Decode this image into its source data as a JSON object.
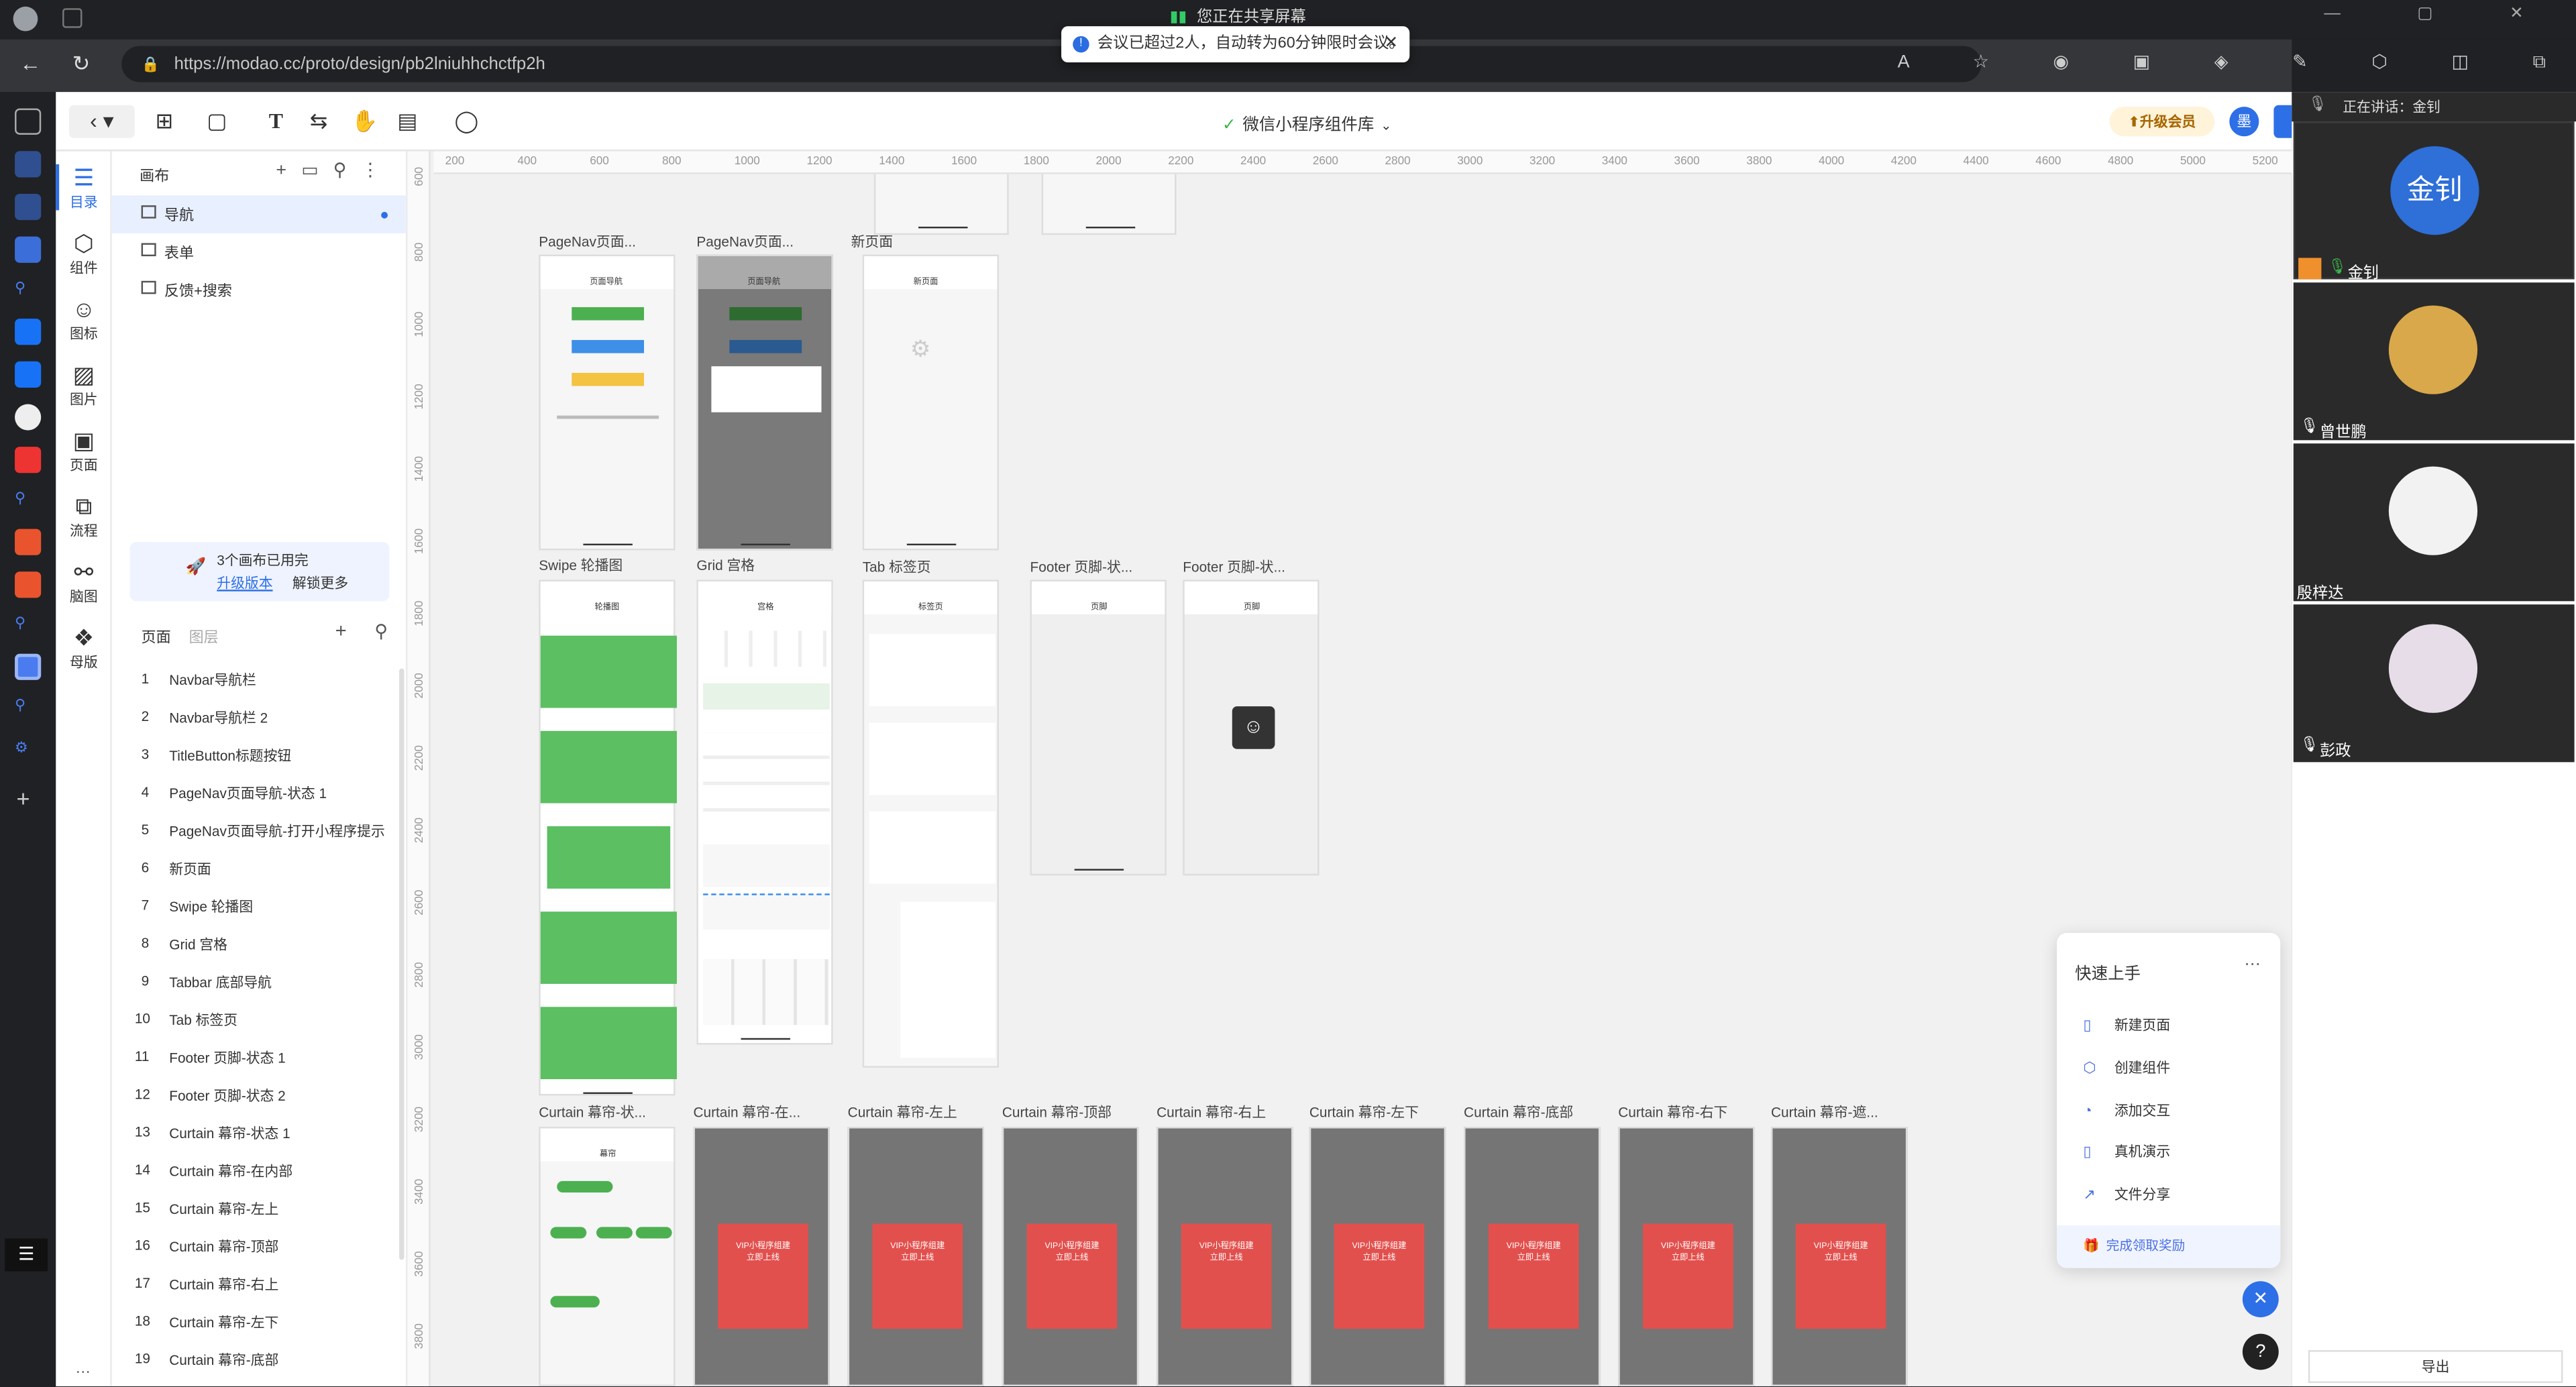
{
  "browser": {
    "sharing": "您正在共享屏幕",
    "url": "https://modao.cc/proto/design/pb2lniuhhchctfp2h",
    "toast": "会议已超过2人，自动转为60分钟限时会议。"
  },
  "app": {
    "project": "微信小程序组件库",
    "upgrade": "升级会员",
    "avatar": "墨"
  },
  "iconbar": [
    {
      "label": "目录",
      "icon": "list-icon"
    },
    {
      "label": "组件",
      "icon": "cube-icon"
    },
    {
      "label": "图标",
      "icon": "smile-icon"
    },
    {
      "label": "图片",
      "icon": "image-icon"
    },
    {
      "label": "页面",
      "icon": "page-icon"
    },
    {
      "label": "流程",
      "icon": "flow-icon"
    },
    {
      "label": "脑图",
      "icon": "mindmap-icon"
    },
    {
      "label": "母版",
      "icon": "master-icon"
    }
  ],
  "canvas_panel": {
    "title": "画布",
    "items": [
      "导航",
      "表单",
      "反馈+搜索"
    ],
    "quota": "3个画布已用完",
    "upgrade_link": "升级版本",
    "unlock": "解锁更多"
  },
  "pages": {
    "tabs": [
      "页面",
      "图层"
    ],
    "items": [
      {
        "n": "1",
        "t": "Navbar导航栏"
      },
      {
        "n": "2",
        "t": "Navbar导航栏 2"
      },
      {
        "n": "3",
        "t": "TitleButton标题按钮"
      },
      {
        "n": "4",
        "t": "PageNav页面导航-状态 1"
      },
      {
        "n": "5",
        "t": "PageNav页面导航-打开小程序提示"
      },
      {
        "n": "6",
        "t": "新页面"
      },
      {
        "n": "7",
        "t": "Swipe 轮播图"
      },
      {
        "n": "8",
        "t": "Grid 宫格"
      },
      {
        "n": "9",
        "t": "Tabbar 底部导航"
      },
      {
        "n": "10",
        "t": "Tab 标签页"
      },
      {
        "n": "11",
        "t": "Footer 页脚-状态 1"
      },
      {
        "n": "12",
        "t": "Footer 页脚-状态 2"
      },
      {
        "n": "13",
        "t": "Curtain 幕帘-状态 1"
      },
      {
        "n": "14",
        "t": "Curtain 幕帘-在内部"
      },
      {
        "n": "15",
        "t": "Curtain 幕帘-左上"
      },
      {
        "n": "16",
        "t": "Curtain 幕帘-顶部"
      },
      {
        "n": "17",
        "t": "Curtain 幕帘-右上"
      },
      {
        "n": "18",
        "t": "Curtain 幕帘-左下"
      },
      {
        "n": "19",
        "t": "Curtain 幕帘-底部"
      }
    ]
  },
  "ruler_h": [
    "200",
    "400",
    "600",
    "800",
    "1000",
    "1200",
    "1400",
    "1600",
    "1800",
    "2000",
    "2200",
    "2400",
    "2600",
    "2800",
    "3000",
    "3200",
    "3400",
    "3600",
    "3800",
    "4000",
    "4200",
    "4400",
    "4600",
    "4800",
    "5000",
    "5200"
  ],
  "ruler_v": [
    "600",
    "800",
    "1000",
    "1200",
    "1400",
    "1600",
    "1800",
    "2000",
    "2200",
    "2400",
    "2600",
    "2800",
    "3000",
    "3200",
    "3400",
    "3600",
    "3800"
  ],
  "frames": {
    "row1": [
      "PageNav页面...",
      "PageNav页面...",
      "新页面"
    ],
    "row2": [
      "Swipe 轮播图",
      "Grid 宫格",
      "Tab 标签页",
      "Footer 页脚-状...",
      "Footer 页脚-状..."
    ],
    "row3": [
      "Curtain 幕帘-状...",
      "Curtain 幕帘-在...",
      "Curtain 幕帘-左上",
      "Curtain 幕帘-顶部",
      "Curtain 幕帘-右上",
      "Curtain 幕帘-左下",
      "Curtain 幕帘-底部",
      "Curtain 幕帘-右下",
      "Curtain 幕帘-遮..."
    ],
    "screen_titles": [
      "页面导航",
      "页面导航",
      "新页面",
      "轮播图",
      "宫格",
      "标签页",
      "页脚",
      "页脚",
      "幕帘"
    ],
    "vip_text": "VIP小程序组建\n立即上线"
  },
  "quickstart": {
    "title": "快速上手",
    "items": [
      "新建页面",
      "创建组件",
      "添加交互",
      "真机演示",
      "文件分享"
    ],
    "reward": "完成领取奖励"
  },
  "meeting": {
    "speaking": "正在讲话：金钊",
    "participants": [
      {
        "name": "金钊",
        "avatar": "金钊"
      },
      {
        "name": "曾世鹏"
      },
      {
        "name": "殷梓达"
      },
      {
        "name": "彭政"
      }
    ],
    "export": "导出"
  }
}
